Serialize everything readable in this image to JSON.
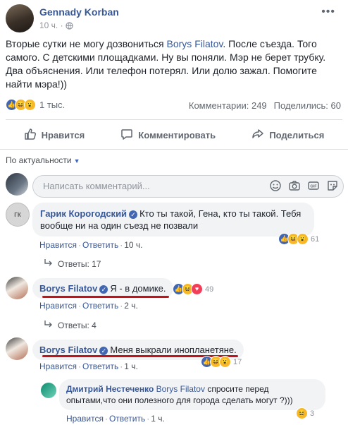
{
  "post": {
    "author": "Gennady Korban",
    "time": "10 ч.",
    "privacy_icon": "globe-icon",
    "text_before": "Вторые сутки не могу дозвониться ",
    "mention": "Borys Filatov",
    "text_after": ". После съезда. Того самого. С детскими площадками. Ну вы поняли. Мэр не берет трубку. Два объяснения. Или телефон потерял. Или долю зажал. Помогите найти мэра!))",
    "reactions_count": "1 тыс.",
    "comments_count": "Комментарии: 249",
    "shares_count": "Поделились: 60"
  },
  "actions": {
    "like": "Нравится",
    "comment": "Комментировать",
    "share": "Поделиться"
  },
  "sort": {
    "label": "По актуальности"
  },
  "composer": {
    "placeholder": "Написать комментарий..."
  },
  "comments": [
    {
      "author": "Гарик Корогодский",
      "verified": true,
      "text": "Кто ты такой, Гена, кто ты такой. Тебя вообще ни на один съезд не позвали",
      "like_label": "Нравится",
      "reply_label": "Ответить",
      "time": "10 ч.",
      "reactions_count": "61",
      "replies_label": "Ответы: 17"
    },
    {
      "author": "Borys Filatov",
      "verified": true,
      "text": "Я - в домике.",
      "like_label": "Нравится",
      "reply_label": "Ответить",
      "time": "2 ч.",
      "reactions_count": "49",
      "replies_label": "Ответы: 4"
    },
    {
      "author": "Borys Filatov",
      "verified": true,
      "text": "Меня выкрали инопланетяне.",
      "like_label": "Нравится",
      "reply_label": "Ответить",
      "time": "1 ч.",
      "reactions_count": "17"
    }
  ],
  "reply": {
    "author": "Дмитрий Нестеченко",
    "mention": "Borys Filatov",
    "text": " спросите перед опытами,что они полезного для города сделать могут ?)))",
    "like_label": "Нравится",
    "reply_label": "Ответить",
    "time": "1 ч.",
    "reactions_count": "3"
  },
  "colors": {
    "link": "#365899",
    "like_blue": "#4267b2",
    "underline_red": "#c0131a",
    "bubble_bg": "#f2f3f5"
  }
}
